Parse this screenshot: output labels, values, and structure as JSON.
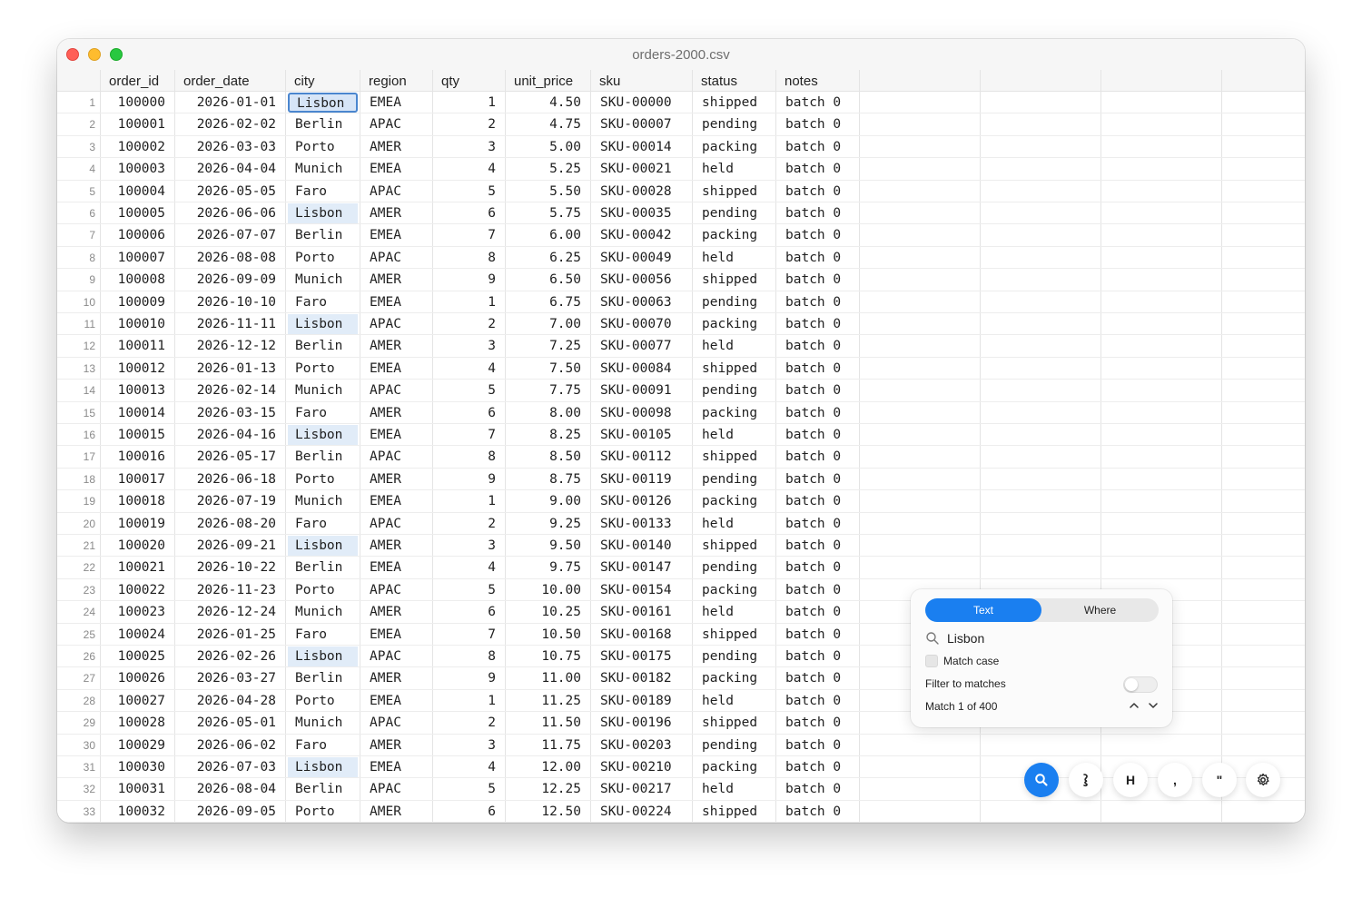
{
  "window": {
    "title": "orders-2000.csv"
  },
  "columns": [
    "order_id",
    "order_date",
    "city",
    "region",
    "qty",
    "unit_price",
    "sku",
    "status",
    "notes"
  ],
  "rows": [
    [
      "1",
      "100000",
      "2026-01-01",
      "Lisbon",
      "EMEA",
      "1",
      "4.50",
      "SKU-00000",
      "shipped",
      "batch 0"
    ],
    [
      "2",
      "100001",
      "2026-02-02",
      "Berlin",
      "APAC",
      "2",
      "4.75",
      "SKU-00007",
      "pending",
      "batch 0"
    ],
    [
      "3",
      "100002",
      "2026-03-03",
      "Porto",
      "AMER",
      "3",
      "5.00",
      "SKU-00014",
      "packing",
      "batch 0"
    ],
    [
      "4",
      "100003",
      "2026-04-04",
      "Munich",
      "EMEA",
      "4",
      "5.25",
      "SKU-00021",
      "held",
      "batch 0"
    ],
    [
      "5",
      "100004",
      "2026-05-05",
      "Faro",
      "APAC",
      "5",
      "5.50",
      "SKU-00028",
      "shipped",
      "batch 0"
    ],
    [
      "6",
      "100005",
      "2026-06-06",
      "Lisbon",
      "AMER",
      "6",
      "5.75",
      "SKU-00035",
      "pending",
      "batch 0"
    ],
    [
      "7",
      "100006",
      "2026-07-07",
      "Berlin",
      "EMEA",
      "7",
      "6.00",
      "SKU-00042",
      "packing",
      "batch 0"
    ],
    [
      "8",
      "100007",
      "2026-08-08",
      "Porto",
      "APAC",
      "8",
      "6.25",
      "SKU-00049",
      "held",
      "batch 0"
    ],
    [
      "9",
      "100008",
      "2026-09-09",
      "Munich",
      "AMER",
      "9",
      "6.50",
      "SKU-00056",
      "shipped",
      "batch 0"
    ],
    [
      "10",
      "100009",
      "2026-10-10",
      "Faro",
      "EMEA",
      "1",
      "6.75",
      "SKU-00063",
      "pending",
      "batch 0"
    ],
    [
      "11",
      "100010",
      "2026-11-11",
      "Lisbon",
      "APAC",
      "2",
      "7.00",
      "SKU-00070",
      "packing",
      "batch 0"
    ],
    [
      "12",
      "100011",
      "2026-12-12",
      "Berlin",
      "AMER",
      "3",
      "7.25",
      "SKU-00077",
      "held",
      "batch 0"
    ],
    [
      "13",
      "100012",
      "2026-01-13",
      "Porto",
      "EMEA",
      "4",
      "7.50",
      "SKU-00084",
      "shipped",
      "batch 0"
    ],
    [
      "14",
      "100013",
      "2026-02-14",
      "Munich",
      "APAC",
      "5",
      "7.75",
      "SKU-00091",
      "pending",
      "batch 0"
    ],
    [
      "15",
      "100014",
      "2026-03-15",
      "Faro",
      "AMER",
      "6",
      "8.00",
      "SKU-00098",
      "packing",
      "batch 0"
    ],
    [
      "16",
      "100015",
      "2026-04-16",
      "Lisbon",
      "EMEA",
      "7",
      "8.25",
      "SKU-00105",
      "held",
      "batch 0"
    ],
    [
      "17",
      "100016",
      "2026-05-17",
      "Berlin",
      "APAC",
      "8",
      "8.50",
      "SKU-00112",
      "shipped",
      "batch 0"
    ],
    [
      "18",
      "100017",
      "2026-06-18",
      "Porto",
      "AMER",
      "9",
      "8.75",
      "SKU-00119",
      "pending",
      "batch 0"
    ],
    [
      "19",
      "100018",
      "2026-07-19",
      "Munich",
      "EMEA",
      "1",
      "9.00",
      "SKU-00126",
      "packing",
      "batch 0"
    ],
    [
      "20",
      "100019",
      "2026-08-20",
      "Faro",
      "APAC",
      "2",
      "9.25",
      "SKU-00133",
      "held",
      "batch 0"
    ],
    [
      "21",
      "100020",
      "2026-09-21",
      "Lisbon",
      "AMER",
      "3",
      "9.50",
      "SKU-00140",
      "shipped",
      "batch 0"
    ],
    [
      "22",
      "100021",
      "2026-10-22",
      "Berlin",
      "EMEA",
      "4",
      "9.75",
      "SKU-00147",
      "pending",
      "batch 0"
    ],
    [
      "23",
      "100022",
      "2026-11-23",
      "Porto",
      "APAC",
      "5",
      "10.00",
      "SKU-00154",
      "packing",
      "batch 0"
    ],
    [
      "24",
      "100023",
      "2026-12-24",
      "Munich",
      "AMER",
      "6",
      "10.25",
      "SKU-00161",
      "held",
      "batch 0"
    ],
    [
      "25",
      "100024",
      "2026-01-25",
      "Faro",
      "EMEA",
      "7",
      "10.50",
      "SKU-00168",
      "shipped",
      "batch 0"
    ],
    [
      "26",
      "100025",
      "2026-02-26",
      "Lisbon",
      "APAC",
      "8",
      "10.75",
      "SKU-00175",
      "pending",
      "batch 0"
    ],
    [
      "27",
      "100026",
      "2026-03-27",
      "Berlin",
      "AMER",
      "9",
      "11.00",
      "SKU-00182",
      "packing",
      "batch 0"
    ],
    [
      "28",
      "100027",
      "2026-04-28",
      "Porto",
      "EMEA",
      "1",
      "11.25",
      "SKU-00189",
      "held",
      "batch 0"
    ],
    [
      "29",
      "100028",
      "2026-05-01",
      "Munich",
      "APAC",
      "2",
      "11.50",
      "SKU-00196",
      "shipped",
      "batch 0"
    ],
    [
      "30",
      "100029",
      "2026-06-02",
      "Faro",
      "AMER",
      "3",
      "11.75",
      "SKU-00203",
      "pending",
      "batch 0"
    ],
    [
      "31",
      "100030",
      "2026-07-03",
      "Lisbon",
      "EMEA",
      "4",
      "12.00",
      "SKU-00210",
      "packing",
      "batch 0"
    ],
    [
      "32",
      "100031",
      "2026-08-04",
      "Berlin",
      "APAC",
      "5",
      "12.25",
      "SKU-00217",
      "held",
      "batch 0"
    ],
    [
      "33",
      "100032",
      "2026-09-05",
      "Porto",
      "AMER",
      "6",
      "12.50",
      "SKU-00224",
      "shipped",
      "batch 0"
    ]
  ],
  "highlight": {
    "match_value": "Lisbon",
    "current_row": "1",
    "match_color": "#e1ecf8",
    "current_border": "#4a86cf"
  },
  "find_panel": {
    "tab_text": "Text",
    "tab_where": "Where",
    "active_tab": "Text",
    "search_icon": "search-icon",
    "query": "Lisbon",
    "match_case_label": "Match case",
    "match_case_checked": false,
    "filter_label": "Filter to matches",
    "filter_on": false,
    "match_status": "Match 1 of 400",
    "prev_icon": "chevron-up-icon",
    "next_icon": "chevron-down-icon",
    "accent": "#1a7ff0"
  },
  "toolbar": {
    "search_icon": "search-icon",
    "regex_icon": "curly-regex-icon",
    "header_label": "H",
    "comma_label": ",",
    "quote_label": "\"",
    "settings_icon": "gear-icon"
  }
}
